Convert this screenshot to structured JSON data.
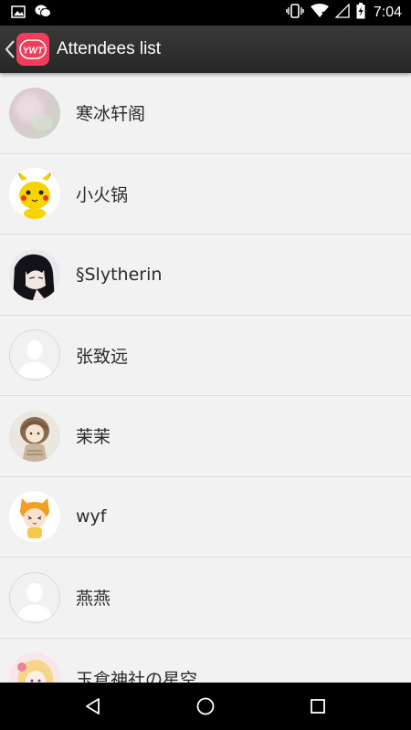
{
  "status_bar": {
    "time": "7:04",
    "icons": [
      "image-icon",
      "wechat-icon",
      "vibrate-icon",
      "wifi-icon",
      "no-signal-icon",
      "battery-charging-icon"
    ]
  },
  "app_bar": {
    "title": "Attendees list",
    "logo_text": "YWT",
    "accent_color": "#ef3d5b"
  },
  "attendees": [
    {
      "name": "寒冰轩阁",
      "avatar": "photo-avatar"
    },
    {
      "name": "小火锅",
      "avatar": "pikachu-avatar"
    },
    {
      "name": "§Slytherin",
      "avatar": "anime-girl-avatar"
    },
    {
      "name": "张致远",
      "avatar": "default-avatar"
    },
    {
      "name": "茉茉",
      "avatar": "doll-avatar"
    },
    {
      "name": "wyf",
      "avatar": "cartoon-fox-avatar"
    },
    {
      "name": "燕燕",
      "avatar": "default-avatar"
    },
    {
      "name": "玉倉神社の星空",
      "avatar": "anime-avatar"
    }
  ],
  "nav_bar": {
    "icons": [
      "back-icon",
      "home-icon",
      "recents-icon"
    ]
  }
}
